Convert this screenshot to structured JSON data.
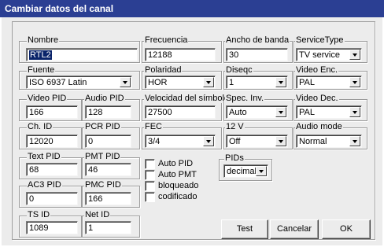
{
  "window": {
    "title": "Cambiar datos del canal"
  },
  "fields": {
    "nombre": {
      "label": "Nombre",
      "value": "RTL2"
    },
    "frecuencia": {
      "label": "Frecuencia",
      "value": "12188"
    },
    "ancho_banda": {
      "label": "Ancho de banda",
      "value": "30"
    },
    "service_type": {
      "label": "ServiceType",
      "value": "TV service"
    },
    "fuente": {
      "label": "Fuente",
      "value": "ISO 6937 Latin"
    },
    "polaridad": {
      "label": "Polaridad",
      "value": "HOR"
    },
    "diseqc": {
      "label": "Diseqc",
      "value": "1"
    },
    "video_enc": {
      "label": "Video Enc.",
      "value": "PAL"
    },
    "video_pid": {
      "label": "Video PID",
      "value": "166"
    },
    "audio_pid": {
      "label": "Audio PID",
      "value": "128"
    },
    "velocidad": {
      "label": "Velocidad del símbolo",
      "value": "27500"
    },
    "spec_inv": {
      "label": "Spec. Inv.",
      "value": "Auto"
    },
    "video_dec": {
      "label": "Video Dec.",
      "value": "PAL"
    },
    "ch_id": {
      "label": "Ch. ID",
      "value": "12020"
    },
    "pcr_pid": {
      "label": "PCR PID",
      "value": "0"
    },
    "fec": {
      "label": "FEC",
      "value": "3/4"
    },
    "v12": {
      "label": "12 V",
      "value": "Off"
    },
    "audio_mode": {
      "label": "Audio mode",
      "value": "Normal"
    },
    "text_pid": {
      "label": "Text PID",
      "value": "68"
    },
    "pmt_pid": {
      "label": "PMT PID",
      "value": "46"
    },
    "ac3_pid": {
      "label": "AC3 PID",
      "value": "0"
    },
    "pmc_pid": {
      "label": "PMC PID",
      "value": "166"
    },
    "ts_id": {
      "label": "TS ID",
      "value": "1089"
    },
    "net_id": {
      "label": "Net ID",
      "value": "1"
    },
    "pids": {
      "label": "PIDs",
      "value": "decimal"
    }
  },
  "checkboxes": {
    "auto_pid": "Auto PID",
    "auto_pmt": "Auto PMT",
    "bloqueado": "bloqueado",
    "codificado": "codificado"
  },
  "buttons": {
    "test": "Test",
    "cancelar": "Cancelar",
    "ok": "OK"
  }
}
